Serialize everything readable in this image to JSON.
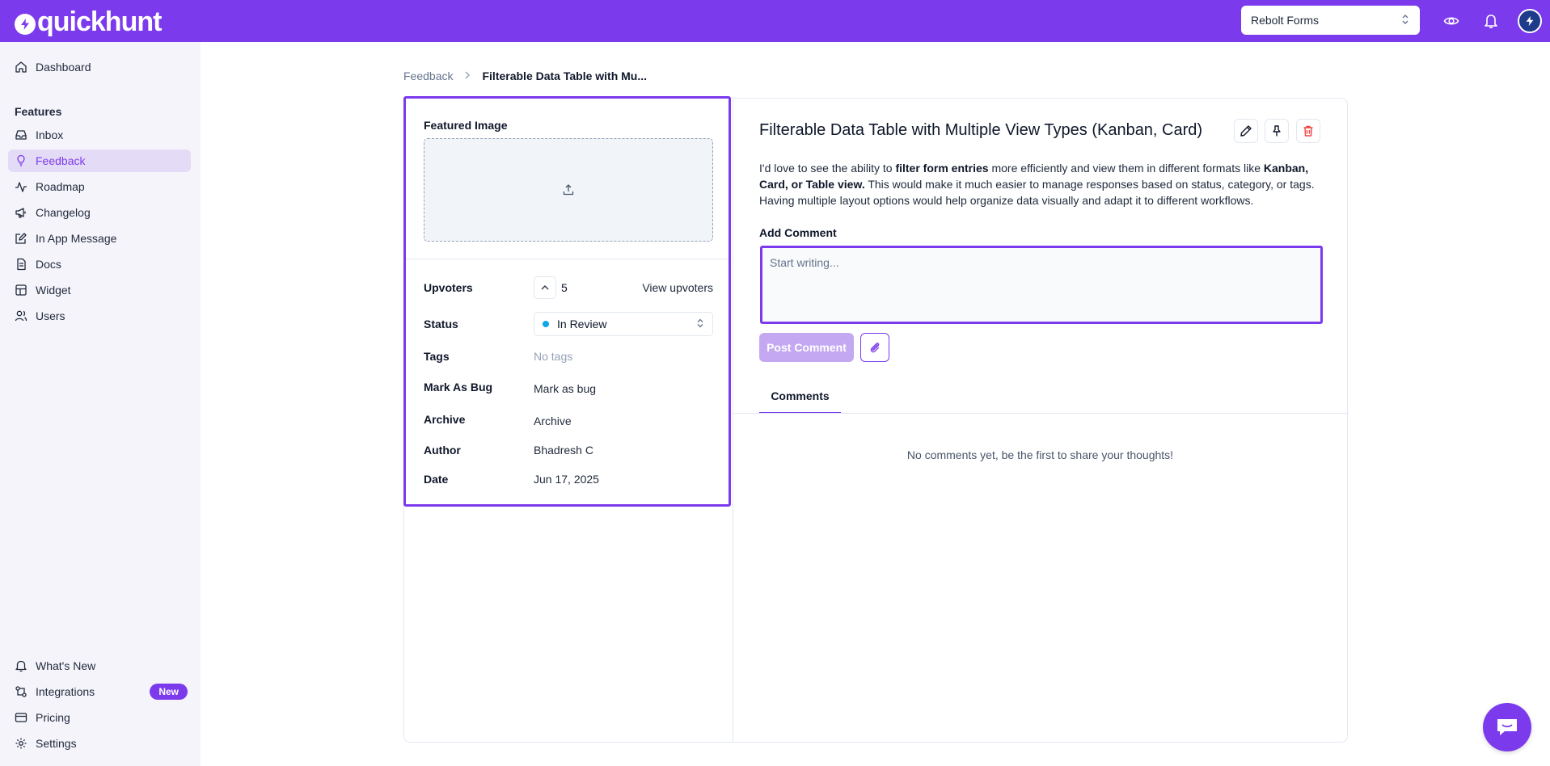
{
  "app": {
    "logo_text": "quickhunt",
    "project_selector": "Rebolt Forms",
    "accent_color": "#7c3aed"
  },
  "sidebar": {
    "items": [
      {
        "label": "Dashboard",
        "icon": "home-icon"
      },
      {
        "label": "Inbox",
        "icon": "inbox-icon"
      },
      {
        "label": "Feedback",
        "icon": "lightbulb-icon",
        "active": true
      },
      {
        "label": "Roadmap",
        "icon": "activity-icon"
      },
      {
        "label": "Changelog",
        "icon": "megaphone-icon"
      },
      {
        "label": "In App Message",
        "icon": "message-edit-icon"
      },
      {
        "label": "Docs",
        "icon": "document-icon"
      },
      {
        "label": "Widget",
        "icon": "widget-icon"
      },
      {
        "label": "Users",
        "icon": "users-icon"
      }
    ],
    "section_label": "Features",
    "bottom": [
      {
        "label": "What's New",
        "icon": "bell-icon"
      },
      {
        "label": "Integrations",
        "icon": "integrations-icon",
        "badge": "New"
      },
      {
        "label": "Pricing",
        "icon": "credit-card-icon"
      },
      {
        "label": "Settings",
        "icon": "gear-icon"
      }
    ]
  },
  "breadcrumb": {
    "parent": "Feedback",
    "current": "Filterable Data Table with Mu..."
  },
  "details": {
    "featured_image_label": "Featured Image",
    "upvoters_label": "Upvoters",
    "upvote_count": "5",
    "view_upvoters": "View upvoters",
    "status_label": "Status",
    "status_value": "In Review",
    "status_color": "#0ea5e9",
    "tags_label": "Tags",
    "tags_value": "No tags",
    "bug_label": "Mark As Bug",
    "bug_value": "Mark as bug",
    "archive_label": "Archive",
    "archive_value": "Archive",
    "author_label": "Author",
    "author_value": "Bhadresh C",
    "date_label": "Date",
    "date_value": "Jun 17, 2025"
  },
  "post": {
    "title": "Filterable Data Table with Multiple View Types (Kanban, Card)",
    "desc_1": "I'd love to see the ability to ",
    "desc_2": "filter form entries",
    "desc_3": " more efficiently and view them in different formats like ",
    "desc_4": "Kanban, Card, or Table view.",
    "desc_5": " This would make it much easier to manage responses based on status, category, or tags. Having multiple layout options would help organize data visually and adapt it to different workflows."
  },
  "comment": {
    "label": "Add Comment",
    "placeholder": "Start writing...",
    "post_button": "Post Comment",
    "tab": "Comments",
    "empty": "No comments yet, be the first to share your thoughts!"
  }
}
